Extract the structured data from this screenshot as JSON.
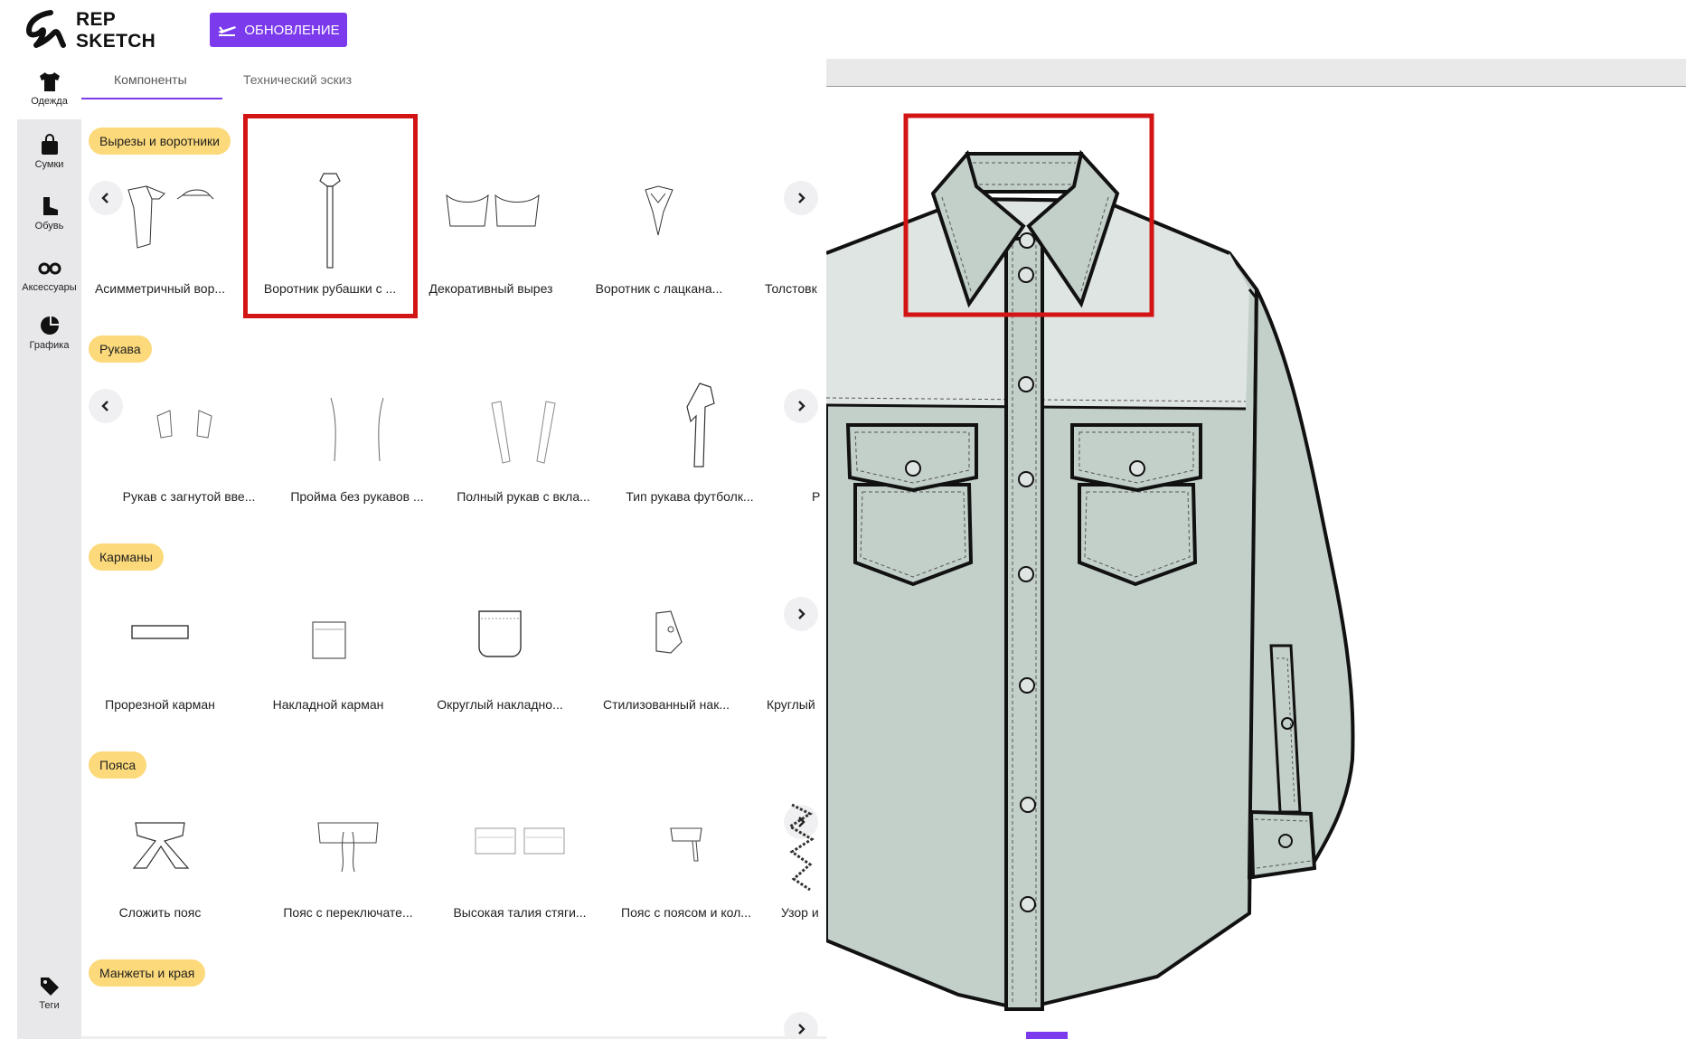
{
  "app": {
    "logo_line1": "REP",
    "logo_line2": "SKETCH",
    "update_button": "ОБНОВЛЕНИЕ",
    "accent_color": "#7c3aed",
    "highlight_color": "#d21414",
    "pill_color": "#fcd97a"
  },
  "rail": {
    "items": [
      {
        "label": "Одежда",
        "icon": "tshirt-icon"
      },
      {
        "label": "Сумки",
        "icon": "bag-icon"
      },
      {
        "label": "Обувь",
        "icon": "boot-icon"
      },
      {
        "label": "Аксессуары",
        "icon": "glasses-icon"
      },
      {
        "label": "Графика",
        "icon": "palette-icon"
      },
      {
        "label": "Теги",
        "icon": "tag-icon"
      }
    ]
  },
  "tabs": [
    {
      "label": "Компоненты",
      "active": true
    },
    {
      "label": "Технический эскиз",
      "active": false
    }
  ],
  "sections": [
    {
      "title": "Вырезы и воротники",
      "items": [
        "Асимметричный вор...",
        "Воротник рубашки с ...",
        "Декоративный вырез",
        "Воротник с лацкана...",
        "Толстовк"
      ]
    },
    {
      "title": "Рукава",
      "items": [
        "Рукав с загнутой вве...",
        "Пройма без рукавов ...",
        "Полный рукав с вкла...",
        "Тип рукава футболк...",
        "Р"
      ]
    },
    {
      "title": "Карманы",
      "items": [
        "Прорезной карман",
        "Накладной карман",
        "Округлый накладно...",
        "Стилизованный нак...",
        "Круглый"
      ]
    },
    {
      "title": "Пояса",
      "items": [
        "Сложить пояс",
        "Пояс с переключате...",
        "Высокая талия стяги...",
        "Пояс с поясом и кол...",
        "Узор и"
      ]
    },
    {
      "title": "Манжеты и края",
      "items": []
    }
  ],
  "canvas": {
    "garment": "shirt-with-collar",
    "garment_fill": "#c3cfc9",
    "yoke_fill": "#dfe5e2"
  }
}
